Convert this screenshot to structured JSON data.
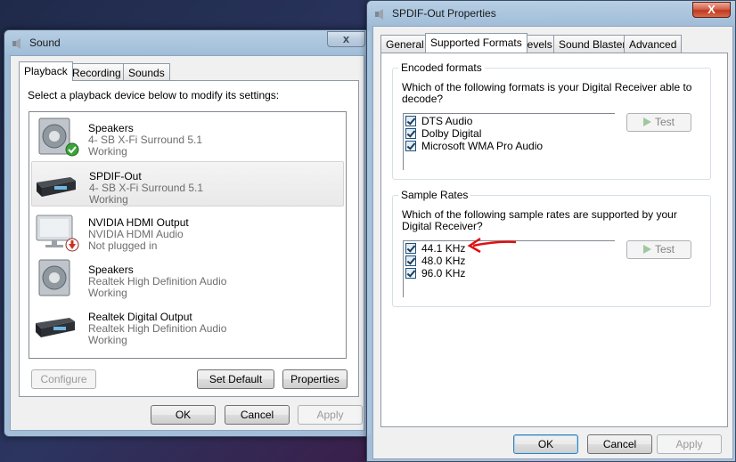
{
  "sound": {
    "title": "Sound",
    "close_label": "x",
    "tabs": [
      {
        "label": "Playback"
      },
      {
        "label": "Recording"
      },
      {
        "label": "Sounds"
      }
    ],
    "instruction": "Select a playback device below to modify its settings:",
    "devices": [
      {
        "name": "Speakers",
        "driver": "4- SB X-Fi Surround 5.1",
        "status": "Working",
        "icon": "speaker-icon"
      },
      {
        "name": "SPDIF-Out",
        "driver": "4- SB X-Fi Surround 5.1",
        "status": "Working",
        "icon": "digital-output-icon"
      },
      {
        "name": "NVIDIA HDMI Output",
        "driver": "NVIDIA HDMI Audio",
        "status": "Not plugged in",
        "icon": "hdmi-monitor-icon"
      },
      {
        "name": "Speakers",
        "driver": "Realtek High Definition Audio",
        "status": "Working",
        "icon": "speaker-icon"
      },
      {
        "name": "Realtek Digital Output",
        "driver": "Realtek High Definition Audio",
        "status": "Working",
        "icon": "digital-output-icon"
      }
    ],
    "buttons": {
      "configure": "Configure",
      "set_default": "Set Default",
      "properties": "Properties",
      "ok": "OK",
      "cancel": "Cancel",
      "apply": "Apply"
    }
  },
  "spdif": {
    "title": "SPDIF-Out Properties",
    "close_label": "X",
    "tabs": [
      {
        "label": "General"
      },
      {
        "label": "Supported Formats"
      },
      {
        "label": "Levels"
      },
      {
        "label": "Sound Blaster"
      },
      {
        "label": "Advanced"
      }
    ],
    "encoded": {
      "title": "Encoded formats",
      "question": "Which of the following formats is your Digital Receiver able to decode?",
      "items": [
        "DTS Audio",
        "Dolby Digital",
        "Microsoft WMA Pro Audio"
      ],
      "test_label": "Test"
    },
    "rates": {
      "title": "Sample Rates",
      "question": "Which of the following sample rates are supported by your Digital Receiver?",
      "items": [
        "44.1 KHz",
        "48.0 KHz",
        "96.0 KHz"
      ],
      "test_label": "Test"
    },
    "buttons": {
      "ok": "OK",
      "cancel": "Cancel",
      "apply": "Apply"
    }
  },
  "colors": {
    "annotation_arrow": "#e01010",
    "check_badge": "#3aa43a",
    "unplugged_badge": "#d03020"
  }
}
